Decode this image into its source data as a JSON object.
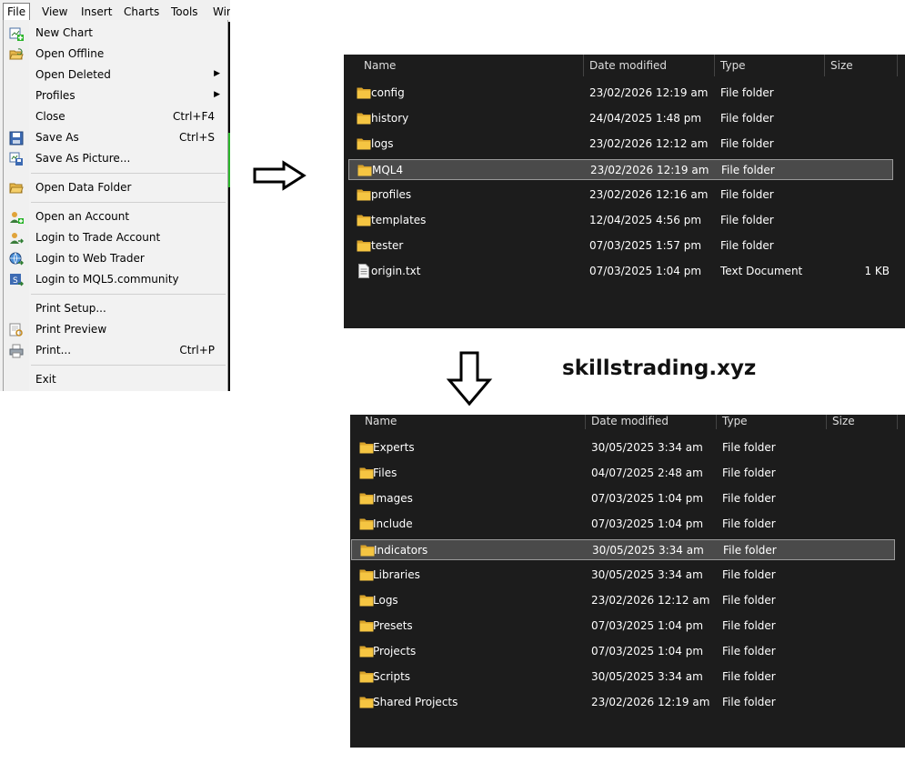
{
  "menubar": {
    "items": [
      "File",
      "View",
      "Insert",
      "Charts",
      "Tools",
      "Win"
    ]
  },
  "file_menu": {
    "items": [
      {
        "label": "New Chart",
        "shortcut": "",
        "icon": "new-chart-icon"
      },
      {
        "label": "Open Offline",
        "shortcut": "",
        "icon": "open-offline-icon"
      },
      {
        "label": "Open Deleted",
        "shortcut": "",
        "icon": "",
        "submenu": true
      },
      {
        "label": "Profiles",
        "shortcut": "",
        "icon": "",
        "submenu": true
      },
      {
        "label": "Close",
        "shortcut": "Ctrl+F4",
        "icon": ""
      },
      {
        "label": "Save As",
        "shortcut": "Ctrl+S",
        "icon": "save-icon"
      },
      {
        "label": "Save As Picture...",
        "shortcut": "",
        "icon": "save-picture-icon"
      },
      {
        "label": "Open Data Folder",
        "shortcut": "",
        "icon": "folder-open-icon"
      },
      {
        "label": "Open an Account",
        "shortcut": "",
        "icon": "add-account-icon"
      },
      {
        "label": "Login to Trade Account",
        "shortcut": "",
        "icon": "login-account-icon"
      },
      {
        "label": "Login to Web Trader",
        "shortcut": "",
        "icon": "web-trader-icon"
      },
      {
        "label": "Login to MQL5.community",
        "shortcut": "",
        "icon": "mql5-community-icon"
      },
      {
        "label": "Print Setup...",
        "shortcut": "",
        "icon": ""
      },
      {
        "label": "Print Preview",
        "shortcut": "",
        "icon": "print-preview-icon"
      },
      {
        "label": "Print...",
        "shortcut": "Ctrl+P",
        "icon": "printer-icon"
      },
      {
        "label": "Exit",
        "shortcut": "",
        "icon": ""
      }
    ]
  },
  "site_text": "skillstrading.xyz",
  "columns": {
    "name": "Name",
    "date": "Date modified",
    "type": "Type",
    "size": "Size"
  },
  "explorer_top": {
    "rows": [
      {
        "name": "config",
        "date": "23/02/2026 12:19 am",
        "type": "File folder",
        "size": "",
        "kind": "folder"
      },
      {
        "name": "history",
        "date": "24/04/2025 1:48 pm",
        "type": "File folder",
        "size": "",
        "kind": "folder"
      },
      {
        "name": "logs",
        "date": "23/02/2026 12:12 am",
        "type": "File folder",
        "size": "",
        "kind": "folder"
      },
      {
        "name": "MQL4",
        "date": "23/02/2026 12:19 am",
        "type": "File folder",
        "size": "",
        "kind": "folder",
        "selected": true
      },
      {
        "name": "profiles",
        "date": "23/02/2026 12:16 am",
        "type": "File folder",
        "size": "",
        "kind": "folder"
      },
      {
        "name": "templates",
        "date": "12/04/2025 4:56 pm",
        "type": "File folder",
        "size": "",
        "kind": "folder"
      },
      {
        "name": "tester",
        "date": "07/03/2025 1:57 pm",
        "type": "File folder",
        "size": "",
        "kind": "folder"
      },
      {
        "name": "origin.txt",
        "date": "07/03/2025 1:04 pm",
        "type": "Text Document",
        "size": "1 KB",
        "kind": "file"
      }
    ]
  },
  "explorer_bottom": {
    "rows": [
      {
        "name": "Experts",
        "date": "30/05/2025 3:34 am",
        "type": "File folder",
        "size": "",
        "kind": "folder"
      },
      {
        "name": "Files",
        "date": "04/07/2025 2:48 am",
        "type": "File folder",
        "size": "",
        "kind": "folder"
      },
      {
        "name": "Images",
        "date": "07/03/2025 1:04 pm",
        "type": "File folder",
        "size": "",
        "kind": "folder"
      },
      {
        "name": "Include",
        "date": "07/03/2025 1:04 pm",
        "type": "File folder",
        "size": "",
        "kind": "folder"
      },
      {
        "name": "Indicators",
        "date": "30/05/2025 3:34 am",
        "type": "File folder",
        "size": "",
        "kind": "folder",
        "selected": true
      },
      {
        "name": "Libraries",
        "date": "30/05/2025 3:34 am",
        "type": "File folder",
        "size": "",
        "kind": "folder"
      },
      {
        "name": "Logs",
        "date": "23/02/2026 12:12 am",
        "type": "File folder",
        "size": "",
        "kind": "folder"
      },
      {
        "name": "Presets",
        "date": "07/03/2025 1:04 pm",
        "type": "File folder",
        "size": "",
        "kind": "folder"
      },
      {
        "name": "Projects",
        "date": "07/03/2025 1:04 pm",
        "type": "File folder",
        "size": "",
        "kind": "folder"
      },
      {
        "name": "Scripts",
        "date": "30/05/2025 3:34 am",
        "type": "File folder",
        "size": "",
        "kind": "folder"
      },
      {
        "name": "Shared Projects",
        "date": "23/02/2026 12:19 am",
        "type": "File folder",
        "size": "",
        "kind": "folder"
      }
    ]
  },
  "colors": {
    "explorer_bg": "#1c1c1c",
    "folder_yellow": "#f5c542",
    "selection": "#4a4a4a"
  }
}
